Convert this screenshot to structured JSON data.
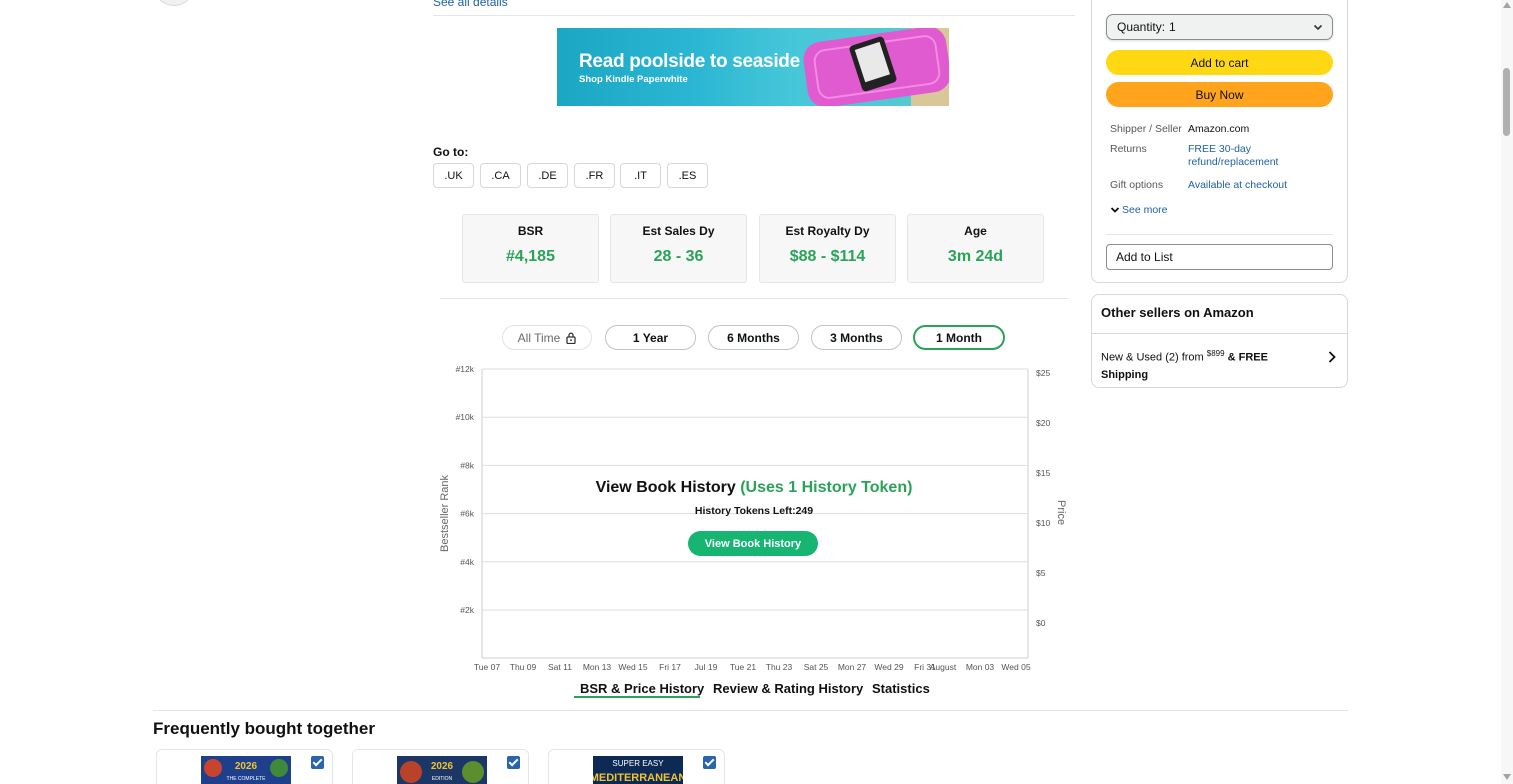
{
  "left_column": {
    "see_all_details": "See all details"
  },
  "ad": {
    "headline": "Read poolside to seaside",
    "subline": "Shop Kindle Paperwhite"
  },
  "goto": {
    "label": "Go to:",
    "stores": [
      ".UK",
      ".CA",
      ".DE",
      ".FR",
      ".IT",
      ".ES"
    ]
  },
  "stats": [
    {
      "label": "BSR",
      "value": "#4,185"
    },
    {
      "label": "Est Sales Dy",
      "value": "28 - 36"
    },
    {
      "label": "Est Royalty Dy",
      "value": "$88 - $114"
    },
    {
      "label": "Age",
      "value": "3m 24d"
    }
  ],
  "ranges": [
    {
      "label": "All Time",
      "locked": true,
      "active": false
    },
    {
      "label": "1 Year",
      "locked": false,
      "active": false
    },
    {
      "label": "6 Months",
      "locked": false,
      "active": false
    },
    {
      "label": "3 Months",
      "locked": false,
      "active": false
    },
    {
      "label": "1 Month",
      "locked": false,
      "active": true
    }
  ],
  "chart": {
    "left_axis_title": "Bestseller Rank",
    "right_axis_title": "Price",
    "left_ticks": [
      "#12k",
      "#10k",
      "#8k",
      "#6k",
      "#4k",
      "#2k"
    ],
    "right_ticks": [
      "$25",
      "$20",
      "$15",
      "$10",
      "$5",
      "$0"
    ],
    "x_ticks": [
      "Tue 07",
      "Thu 09",
      "Sat 11",
      "Mon 13",
      "Wed 15",
      "Fri 17",
      "Jul 19",
      "Tue 21",
      "Thu 23",
      "Sat 25",
      "Mon 27",
      "Wed 29",
      "Fri 31",
      "August",
      "Mon 03",
      "Wed 05"
    ],
    "overlay_title": "View Book History",
    "overlay_title_green": "(Uses 1 History Token)",
    "overlay_tokens": "History Tokens Left:249",
    "overlay_button": "View Book History"
  },
  "history_tabs": [
    "BSR & Price History",
    "Review & Rating History",
    "Statistics"
  ],
  "fbt": {
    "title": "Frequently bought together",
    "items": [
      {
        "cover_text": "2026",
        "cover_sub": "THE COMPLETE"
      },
      {
        "cover_text": "2026",
        "cover_sub": "EDITION"
      },
      {
        "cover_text": "SUPER EASY",
        "cover_sub": "MEDITERRANEAN"
      }
    ]
  },
  "buybox": {
    "quantity_label": "Quantity:",
    "quantity_value": "1",
    "add_to_cart": "Add to cart",
    "buy_now": "Buy Now",
    "shipper_label": "Shipper / Seller",
    "shipper_value": "Amazon.com",
    "returns_label": "Returns",
    "returns_value_1": "FREE 30-day",
    "returns_value_2": "refund/replacement",
    "gift_label": "Gift options",
    "gift_value": "Available at checkout",
    "see_more": "See more",
    "add_to_list": "Add to List"
  },
  "other_sellers": {
    "title": "Other sellers on Amazon",
    "prefix": "New & Used (2) from ",
    "price_dollars": "$8",
    "price_cents": "99",
    "suffix": " & FREE",
    "shipping": "Shipping"
  },
  "colors": {
    "green": "#2aa358",
    "button_green": "#16b672",
    "cart_yellow": "#ffd814",
    "buy_orange": "#ffa41c",
    "link_blue": "#2162a1"
  }
}
